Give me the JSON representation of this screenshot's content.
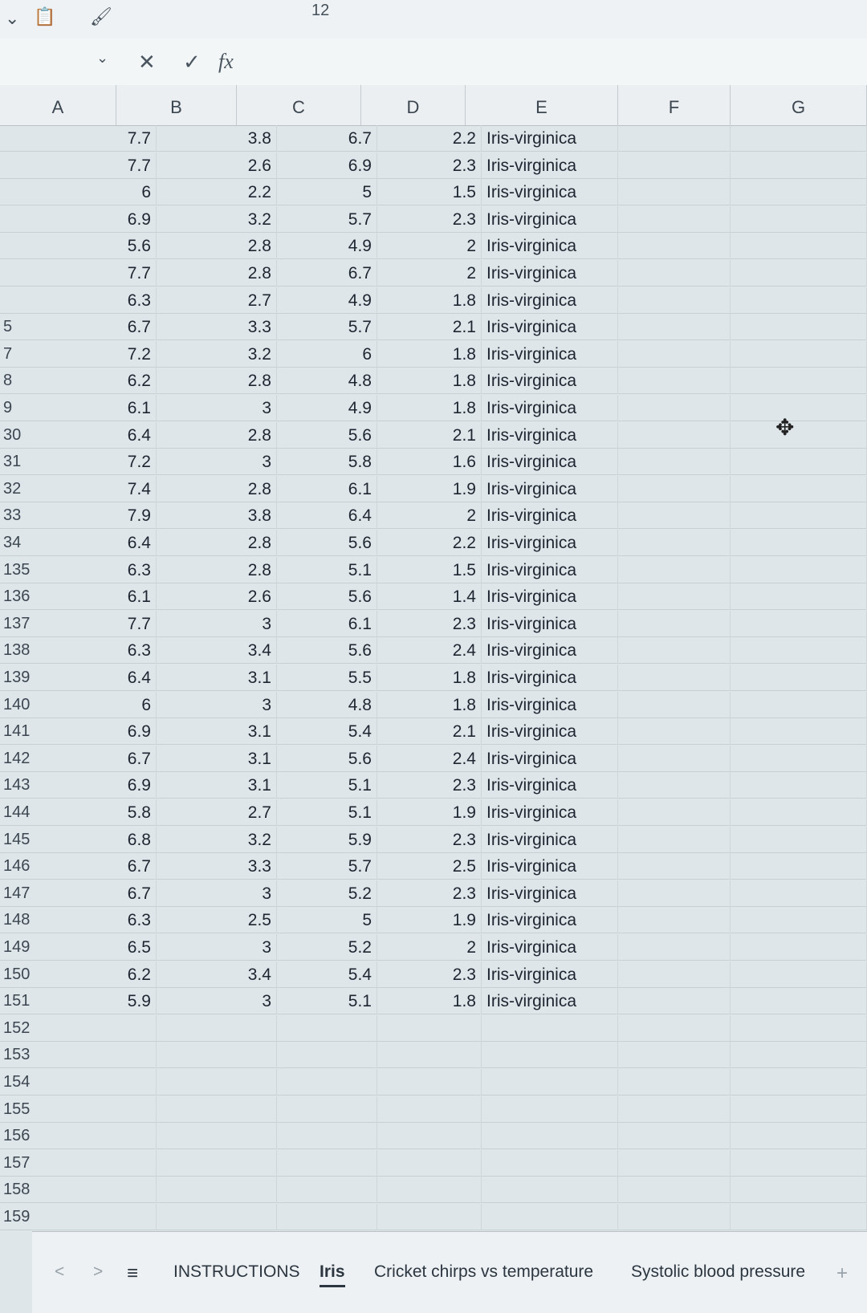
{
  "ribbon": {
    "font_size": "12",
    "undo_glyph": "✓",
    "clipboard_glyph": "📋",
    "brush_glyph": "🖌"
  },
  "formula_bar": {
    "fx": "fx",
    "cancel": "✕",
    "confirm": "✓",
    "name_box_glyph": "⌄"
  },
  "columns": [
    "A",
    "B",
    "C",
    "D",
    "E",
    "F",
    "G"
  ],
  "rows": [
    {
      "num": "",
      "a": "7.7",
      "b": "3.8",
      "c": "6.7",
      "d": "2.2",
      "e": "Iris-virginica"
    },
    {
      "num": "",
      "a": "7.7",
      "b": "2.6",
      "c": "6.9",
      "d": "2.3",
      "e": "Iris-virginica"
    },
    {
      "num": "",
      "a": "6",
      "b": "2.2",
      "c": "5",
      "d": "1.5",
      "e": "Iris-virginica"
    },
    {
      "num": "",
      "a": "6.9",
      "b": "3.2",
      "c": "5.7",
      "d": "2.3",
      "e": "Iris-virginica"
    },
    {
      "num": "",
      "a": "5.6",
      "b": "2.8",
      "c": "4.9",
      "d": "2",
      "e": "Iris-virginica"
    },
    {
      "num": "",
      "a": "7.7",
      "b": "2.8",
      "c": "6.7",
      "d": "2",
      "e": "Iris-virginica"
    },
    {
      "num": "",
      "a": "6.3",
      "b": "2.7",
      "c": "4.9",
      "d": "1.8",
      "e": "Iris-virginica"
    },
    {
      "num": "5",
      "a": "6.7",
      "b": "3.3",
      "c": "5.7",
      "d": "2.1",
      "e": "Iris-virginica"
    },
    {
      "num": "7",
      "a": "7.2",
      "b": "3.2",
      "c": "6",
      "d": "1.8",
      "e": "Iris-virginica"
    },
    {
      "num": "8",
      "a": "6.2",
      "b": "2.8",
      "c": "4.8",
      "d": "1.8",
      "e": "Iris-virginica"
    },
    {
      "num": "9",
      "a": "6.1",
      "b": "3",
      "c": "4.9",
      "d": "1.8",
      "e": "Iris-virginica"
    },
    {
      "num": "30",
      "a": "6.4",
      "b": "2.8",
      "c": "5.6",
      "d": "2.1",
      "e": "Iris-virginica"
    },
    {
      "num": "31",
      "a": "7.2",
      "b": "3",
      "c": "5.8",
      "d": "1.6",
      "e": "Iris-virginica"
    },
    {
      "num": "32",
      "a": "7.4",
      "b": "2.8",
      "c": "6.1",
      "d": "1.9",
      "e": "Iris-virginica"
    },
    {
      "num": "33",
      "a": "7.9",
      "b": "3.8",
      "c": "6.4",
      "d": "2",
      "e": "Iris-virginica"
    },
    {
      "num": "34",
      "a": "6.4",
      "b": "2.8",
      "c": "5.6",
      "d": "2.2",
      "e": "Iris-virginica"
    },
    {
      "num": "135",
      "a": "6.3",
      "b": "2.8",
      "c": "5.1",
      "d": "1.5",
      "e": "Iris-virginica"
    },
    {
      "num": "136",
      "a": "6.1",
      "b": "2.6",
      "c": "5.6",
      "d": "1.4",
      "e": "Iris-virginica"
    },
    {
      "num": "137",
      "a": "7.7",
      "b": "3",
      "c": "6.1",
      "d": "2.3",
      "e": "Iris-virginica"
    },
    {
      "num": "138",
      "a": "6.3",
      "b": "3.4",
      "c": "5.6",
      "d": "2.4",
      "e": "Iris-virginica"
    },
    {
      "num": "139",
      "a": "6.4",
      "b": "3.1",
      "c": "5.5",
      "d": "1.8",
      "e": "Iris-virginica"
    },
    {
      "num": "140",
      "a": "6",
      "b": "3",
      "c": "4.8",
      "d": "1.8",
      "e": "Iris-virginica"
    },
    {
      "num": "141",
      "a": "6.9",
      "b": "3.1",
      "c": "5.4",
      "d": "2.1",
      "e": "Iris-virginica"
    },
    {
      "num": "142",
      "a": "6.7",
      "b": "3.1",
      "c": "5.6",
      "d": "2.4",
      "e": "Iris-virginica"
    },
    {
      "num": "143",
      "a": "6.9",
      "b": "3.1",
      "c": "5.1",
      "d": "2.3",
      "e": "Iris-virginica"
    },
    {
      "num": "144",
      "a": "5.8",
      "b": "2.7",
      "c": "5.1",
      "d": "1.9",
      "e": "Iris-virginica"
    },
    {
      "num": "145",
      "a": "6.8",
      "b": "3.2",
      "c": "5.9",
      "d": "2.3",
      "e": "Iris-virginica"
    },
    {
      "num": "146",
      "a": "6.7",
      "b": "3.3",
      "c": "5.7",
      "d": "2.5",
      "e": "Iris-virginica"
    },
    {
      "num": "147",
      "a": "6.7",
      "b": "3",
      "c": "5.2",
      "d": "2.3",
      "e": "Iris-virginica"
    },
    {
      "num": "148",
      "a": "6.3",
      "b": "2.5",
      "c": "5",
      "d": "1.9",
      "e": "Iris-virginica"
    },
    {
      "num": "149",
      "a": "6.5",
      "b": "3",
      "c": "5.2",
      "d": "2",
      "e": "Iris-virginica"
    },
    {
      "num": "150",
      "a": "6.2",
      "b": "3.4",
      "c": "5.4",
      "d": "2.3",
      "e": "Iris-virginica"
    },
    {
      "num": "151",
      "a": "5.9",
      "b": "3",
      "c": "5.1",
      "d": "1.8",
      "e": "Iris-virginica"
    },
    {
      "num": "152",
      "a": "",
      "b": "",
      "c": "",
      "d": "",
      "e": ""
    },
    {
      "num": "153",
      "a": "",
      "b": "",
      "c": "",
      "d": "",
      "e": ""
    },
    {
      "num": "154",
      "a": "",
      "b": "",
      "c": "",
      "d": "",
      "e": ""
    },
    {
      "num": "155",
      "a": "",
      "b": "",
      "c": "",
      "d": "",
      "e": ""
    },
    {
      "num": "156",
      "a": "",
      "b": "",
      "c": "",
      "d": "",
      "e": ""
    },
    {
      "num": "157",
      "a": "",
      "b": "",
      "c": "",
      "d": "",
      "e": ""
    },
    {
      "num": "158",
      "a": "",
      "b": "",
      "c": "",
      "d": "",
      "e": ""
    },
    {
      "num": "159",
      "a": "",
      "b": "",
      "c": "",
      "d": "",
      "e": ""
    }
  ],
  "sheet_tabs": {
    "nav_prev": "<",
    "nav_next": ">",
    "menu": "≡",
    "tabs": [
      "INSTRUCTIONS",
      "Iris",
      "Cricket chirps vs temperature",
      "Systolic blood pressure"
    ],
    "active": "Iris",
    "add": "+"
  },
  "cursor_glyph": "✥"
}
